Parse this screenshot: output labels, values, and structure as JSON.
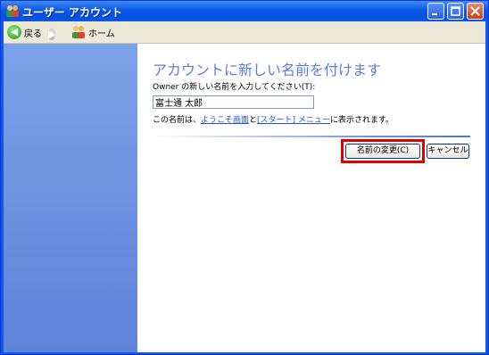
{
  "window": {
    "title": "ユーザー アカウント"
  },
  "toolbar": {
    "back_label": "戻る",
    "home_label": "ホーム"
  },
  "main": {
    "heading": "アカウントに新しい名前を付けます",
    "prompt": "Owner の新しい名前を入力してください(T):",
    "name_value": "富士通 太郎",
    "desc_prefix": "この名前は、",
    "welcome_link": "ようこそ画面",
    "desc_and": "と",
    "start_link": "[スタート] メニュー",
    "desc_suffix": "に表示されます。"
  },
  "buttons": {
    "rename": "名前の変更(C)",
    "cancel": "キャンセル"
  }
}
